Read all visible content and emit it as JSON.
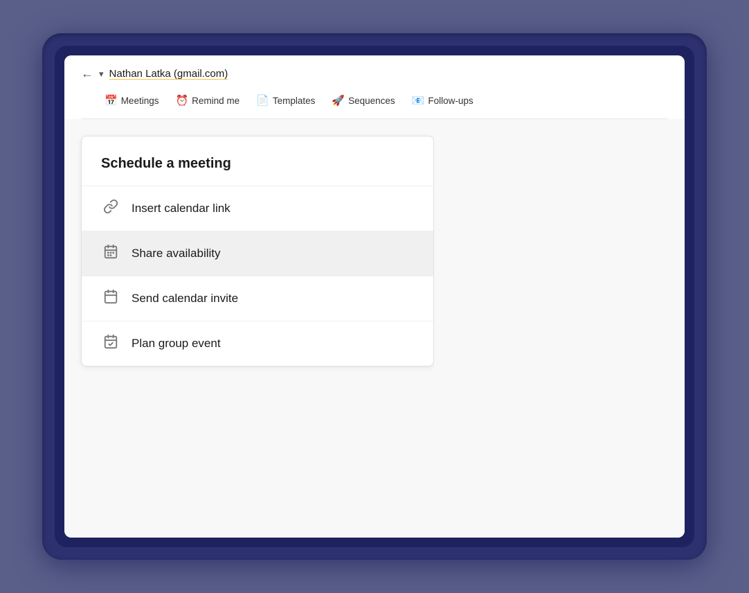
{
  "outerFrame": {
    "bgColor": "#2d3170"
  },
  "header": {
    "recipientName": "Nathan Latka (gmail.com)",
    "backIconLabel": "←",
    "dropdownArrow": "▾"
  },
  "toolbar": {
    "items": [
      {
        "id": "meetings",
        "icon": "📅",
        "label": "Meetings"
      },
      {
        "id": "remind-me",
        "icon": "⏰",
        "label": "Remind me"
      },
      {
        "id": "templates",
        "icon": "📄",
        "label": "Templates"
      },
      {
        "id": "sequences",
        "icon": "🚀",
        "label": "Sequences"
      },
      {
        "id": "follow-ups",
        "icon": "📧",
        "label": "Follow-ups"
      }
    ]
  },
  "panel": {
    "title": "Schedule a meeting",
    "menuItems": [
      {
        "id": "insert-calendar-link",
        "iconType": "link",
        "label": "Insert calendar link",
        "active": false
      },
      {
        "id": "share-availability",
        "iconType": "share-cal",
        "label": "Share availability",
        "active": true
      },
      {
        "id": "send-calendar-invite",
        "iconType": "calendar",
        "label": "Send calendar invite",
        "active": false
      },
      {
        "id": "plan-group-event",
        "iconType": "group-event",
        "label": "Plan group event",
        "active": false
      }
    ]
  }
}
